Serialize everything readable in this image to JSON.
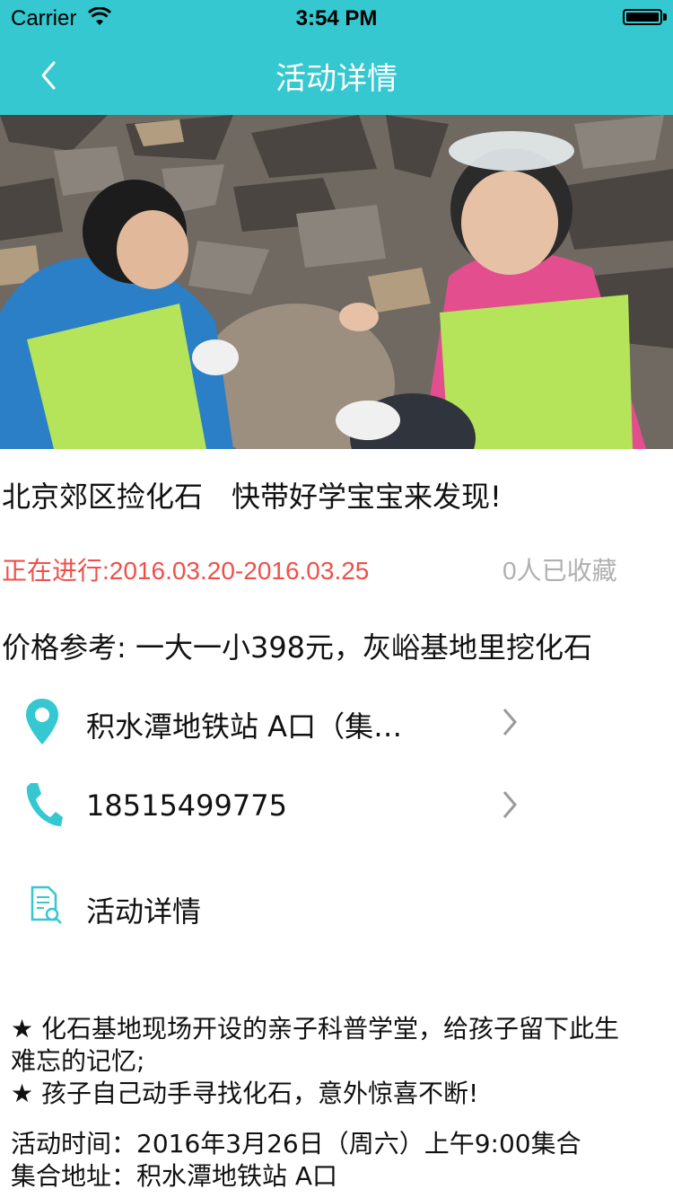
{
  "status_bar": {
    "carrier": "Carrier",
    "time": "3:54 PM"
  },
  "nav": {
    "title": "活动详情"
  },
  "activity": {
    "title": "北京郊区捡化石　快带好学宝宝来发现!",
    "date": "正在进行:2016.03.20-2016.03.25",
    "favorites": "0人已收藏",
    "price": "价格参考: 一大一小398元，灰峪基地里挖化石"
  },
  "rows": {
    "location": "积水潭地铁站 A口（集…",
    "phone": "18515499775",
    "details": "活动详情"
  },
  "description": {
    "line1": "★ 化石基地现场开设的亲子科普学堂，给孩子留下此生",
    "line2": "难忘的记忆;",
    "line3": "★ 孩子自己动手寻找化石，意外惊喜不断!",
    "line4": "活动时间：2016年3月26日（周六）上午9:00集合",
    "line5": "集合地址：积水潭地铁站 A口"
  },
  "colors": {
    "accent": "#35c8d0",
    "date": "#f0504a",
    "muted": "#b0b0b0"
  }
}
